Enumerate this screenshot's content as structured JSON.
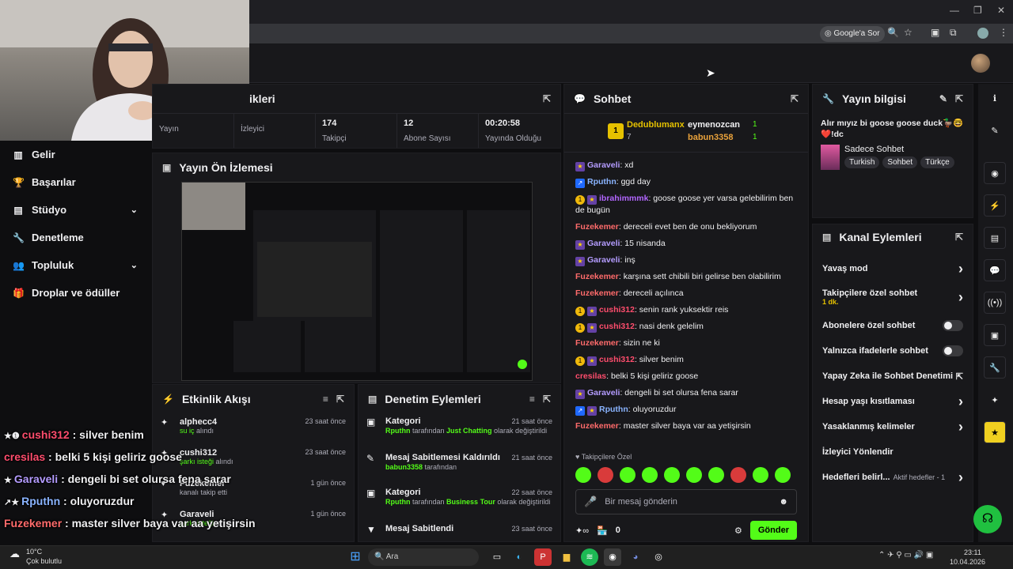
{
  "browser": {
    "ask_google": "Google'a Sor"
  },
  "nav": [
    {
      "label": "Gelir",
      "icon": "bar-chart-icon"
    },
    {
      "label": "Başarılar",
      "icon": "trophy-icon"
    },
    {
      "label": "Stüdyo",
      "icon": "video-icon"
    },
    {
      "label": "Denetleme",
      "icon": "wrench-icon"
    },
    {
      "label": "Topluluk",
      "icon": "people-icon"
    },
    {
      "label": "Droplar ve ödüller",
      "icon": "gift-icon"
    }
  ],
  "stats": {
    "title": "ikleri",
    "cells": [
      {
        "value": "",
        "label": "Yayın"
      },
      {
        "value": "",
        "label": "İzleyici"
      },
      {
        "value": "174",
        "label": "Takipçi"
      },
      {
        "value": "12",
        "label": "Abone Sayısı"
      },
      {
        "value": "00:20:58",
        "label": "Yayında Olduğu"
      }
    ]
  },
  "preview": {
    "title": "Yayın Ön İzlemesi"
  },
  "activity": {
    "title": "Etkinlik Akışı",
    "items": [
      {
        "user": "alphecc4",
        "action": "su iç",
        "suffix": " alındı",
        "time": "23 saat önce"
      },
      {
        "user": "cushi312",
        "action": "şarkı isteği",
        "suffix": " alındı",
        "time": "23 saat önce"
      },
      {
        "user": "Fuzekemer",
        "action": "",
        "suffix": "kanalı takip etti",
        "time": "1 gün önce"
      },
      {
        "user": "Garaveli",
        "action": "şarkı isteği",
        "suffix": " alındı",
        "time": "1 gün önce"
      }
    ]
  },
  "modlog": {
    "title": "Denetim Eylemleri",
    "items": [
      {
        "title": "Kategori",
        "time": "21 saat önce",
        "user": "Rputhn",
        "mid": " tarafından ",
        "target": "Just Chatting",
        "end": " olarak değiştirildi"
      },
      {
        "title": "Mesaj Sabitlemesi Kaldırıldı",
        "time": "21 saat önce",
        "user": "babun3358",
        "mid": " tarafından",
        "target": "",
        "end": ""
      },
      {
        "title": "Kategori",
        "time": "22 saat önce",
        "user": "Rputhn",
        "mid": " tarafından ",
        "target": "Business Tour",
        "end": " olarak değiştirildi"
      },
      {
        "title": "Mesaj Sabitlendi",
        "time": "23 saat önce",
        "user": "",
        "mid": "",
        "target": "",
        "end": ""
      }
    ]
  },
  "chat": {
    "title": "Sohbet",
    "top_gifters": [
      {
        "name": "Dedublumanx",
        "count": "7",
        "color": "#e5c100"
      },
      {
        "name": "eymenozcan",
        "count": "1",
        "color": "#efeff1"
      },
      {
        "name": "babun3358",
        "count": "1",
        "color": "#e9a23b"
      }
    ],
    "messages": [
      {
        "badges": [
          "star"
        ],
        "user": "Garaveli",
        "color": "#b49cff",
        "text": "xd"
      },
      {
        "badges": [
          "blue"
        ],
        "user": "Rputhn",
        "color": "#8ab4ff",
        "text": "ggd day"
      },
      {
        "badges": [
          "gold",
          "star"
        ],
        "user": "ibrahimmmk",
        "color": "#b266ff",
        "text": "goose goose yer varsa gelebilirim ben de bugün"
      },
      {
        "badges": [],
        "user": "Fuzekemer",
        "color": "#ff6b6b",
        "text": "dereceli evet ben de onu bekliyorum"
      },
      {
        "badges": [
          "star"
        ],
        "user": "Garaveli",
        "color": "#b49cff",
        "text": "15 nisanda"
      },
      {
        "badges": [
          "star"
        ],
        "user": "Garaveli",
        "color": "#b49cff",
        "text": "inş"
      },
      {
        "badges": [],
        "user": "Fuzekemer",
        "color": "#ff6b6b",
        "text": "karşına sett chibili biri gelirse ben olabilirim"
      },
      {
        "badges": [],
        "user": "Fuzekemer",
        "color": "#ff6b6b",
        "text": "dereceli açılınca"
      },
      {
        "badges": [
          "gold",
          "star"
        ],
        "user": "cushi312",
        "color": "#ff4d6d",
        "text": "senin rank yuksektir reis"
      },
      {
        "badges": [
          "gold",
          "star"
        ],
        "user": "cushi312",
        "color": "#ff4d6d",
        "text": "nasi denk gelelim"
      },
      {
        "badges": [],
        "user": "Fuzekemer",
        "color": "#ff6b6b",
        "text": "sizin ne ki"
      },
      {
        "badges": [
          "gold",
          "star"
        ],
        "user": "cushi312",
        "color": "#ff4d6d",
        "text": "silver benim"
      },
      {
        "badges": [],
        "user": "cresilas",
        "color": "#ff4d6d",
        "text": "belki 5 kişi geliriz goose"
      },
      {
        "badges": [
          "star"
        ],
        "user": "Garaveli",
        "color": "#b49cff",
        "text": "dengeli bi set olursa fena sarar"
      },
      {
        "badges": [
          "blue",
          "star"
        ],
        "user": "Rputhn",
        "color": "#8ab4ff",
        "text": "oluyoruzdur"
      },
      {
        "badges": [],
        "user": "Fuzekemer",
        "color": "#ff6b6b",
        "text": "master silver baya var aa yetişirsin"
      }
    ],
    "followers_only": "Takipçilere Özel",
    "input_placeholder": "Bir mesaj gönderin",
    "points": "0",
    "send_label": "Gönder"
  },
  "info": {
    "title": "Yayın bilgisi",
    "stream_title": "Alır mıyız bi goose goose duck🦆🤓 ❤️!dc",
    "category": "Sadece Sohbet",
    "tags": [
      "Turkish",
      "Sohbet",
      "Türkçe"
    ]
  },
  "actions": {
    "title": "Kanal Eylemleri",
    "rows": [
      {
        "label": "Yavaş mod",
        "kind": "arrow",
        "sub": ""
      },
      {
        "label": "Takipçilere özel sohbet",
        "kind": "arrow",
        "sub": "1 dk."
      },
      {
        "label": "Abonelere özel sohbet",
        "kind": "toggle",
        "sub": ""
      },
      {
        "label": "Yalnızca ifadelerle sohbet",
        "kind": "toggle",
        "sub": ""
      },
      {
        "label": "Yapay Zeka ile Sohbet Denetimi",
        "kind": "ext",
        "sub": ""
      },
      {
        "label": "Hesap yaşı kısıtlaması",
        "kind": "arrow",
        "sub": ""
      },
      {
        "label": "Yasaklanmış kelimeler",
        "kind": "arrow",
        "sub": ""
      },
      {
        "label": "İzleyici Yönlendir",
        "kind": "none",
        "sub": ""
      },
      {
        "label": "Hedefleri belirl...",
        "kind": "arrow",
        "sub": "Aktif hedefler - 1"
      }
    ]
  },
  "overlay": [
    {
      "user": "cushi312",
      "color": "#ff4d6d",
      "text": " : silver benim",
      "badges": "star-gold"
    },
    {
      "user": "cresilas",
      "color": "#ff4d6d",
      "text": " : belki 5 kişi geliriz goose",
      "badges": ""
    },
    {
      "user": "Garaveli",
      "color": "#b49cff",
      "text": " : dengeli bi set olursa fena sarar",
      "badges": "star"
    },
    {
      "user": "Rputhn",
      "color": "#8ab4ff",
      "text": " : oluyoruzdur",
      "badges": "blue-star"
    },
    {
      "user": "Fuzekemer",
      "color": "#ff6b6b",
      "text": " : master silver baya var aa yetişirsin",
      "badges": ""
    }
  ],
  "taskbar": {
    "weather_temp": "10°C",
    "weather_desc": "Çok bulutlu",
    "search": "Ara",
    "time": "23:11",
    "date": "10.04.2026"
  },
  "colors": {
    "accent": "#53fc18",
    "bg": "#0e0e10",
    "panel": "#18181b"
  }
}
